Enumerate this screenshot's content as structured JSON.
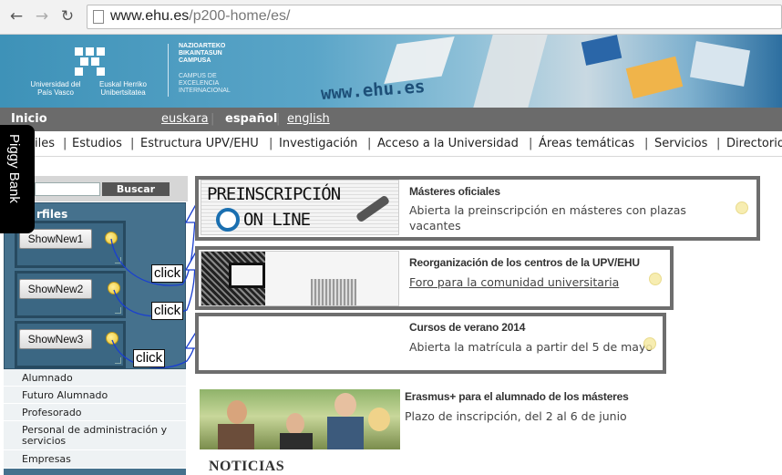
{
  "browser": {
    "url_host": "www.ehu.es",
    "url_path": "/p200-home/es/"
  },
  "banner": {
    "univ_es": "Universidad del País Vasco",
    "univ_eu": "Euskal Herriko Unibertsitatea",
    "campus_eu": "NAZIOARTEKO BIKAINTASUN CAMPUSA",
    "campus_es": "CAMPUS DE EXCELENCIA INTERNACIONAL",
    "site": "www.ehu.es"
  },
  "langbar": {
    "home": "Inicio",
    "euskara": "euskara",
    "espanol": "español",
    "english": "english"
  },
  "menu": [
    "iles",
    "Estudios",
    "Estructura UPV/EHU",
    "Investigación",
    "Acceso a la Universidad",
    "Áreas temáticas",
    "Servicios",
    "Directorio"
  ],
  "piggy_bank": "Piggy Bank",
  "search": {
    "button": "Buscar"
  },
  "perfiles": {
    "title": "rfiles",
    "buttons": [
      "ShowNew1",
      "ShowNew2",
      "ShowNew3"
    ],
    "click_label": "click",
    "items": [
      "Alumnado",
      "Futuro Alumnado",
      "Profesorado",
      "Personal de administración y servicios",
      "Empresas"
    ]
  },
  "features": [
    {
      "title": "Másteres oficiales",
      "desc": "Abierta la preinscripción en másteres con plazas vacantes",
      "image_line1": "PREINSCRIPCIÓN",
      "image_line2": "ON LINE"
    },
    {
      "title": "Reorganización de los centros de la UPV/EHU",
      "desc": "Foro para la comunidad universitaria"
    },
    {
      "title": "Cursos de verano 2014",
      "desc": "Abierta la matrícula a partir del 5 de mayo"
    },
    {
      "title": "Erasmus+ para el alumnado de los másteres",
      "desc": "Plazo de inscripción, del 2 al 6 de junio"
    }
  ],
  "noticias": "NOTICIAS",
  "colors": {
    "banner_blue": "#3e92b8",
    "langbar_gray": "#6b6b6b",
    "perfiles_blue": "#45718d",
    "box_border": "#6e6e6e"
  }
}
